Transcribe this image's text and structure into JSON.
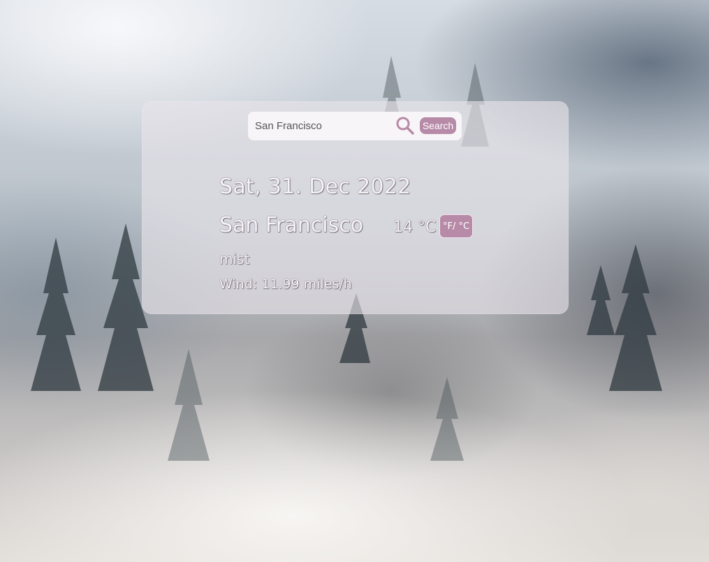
{
  "search": {
    "value": "San Francisco",
    "button_label": "Search",
    "icon": "magnifier-icon"
  },
  "weather": {
    "date": "Sat, 31. Dec 2022",
    "city": "San Francisco",
    "temperature": "14 °C",
    "unit_toggle_label": "°F/ °C",
    "description": "mist",
    "wind": "Wind: 11.99 miles/h"
  },
  "colors": {
    "accent": "#b78aa7",
    "card": "#e8e4ea",
    "text": "#f7f4f7"
  },
  "background": {
    "scene": "misty-forest"
  }
}
